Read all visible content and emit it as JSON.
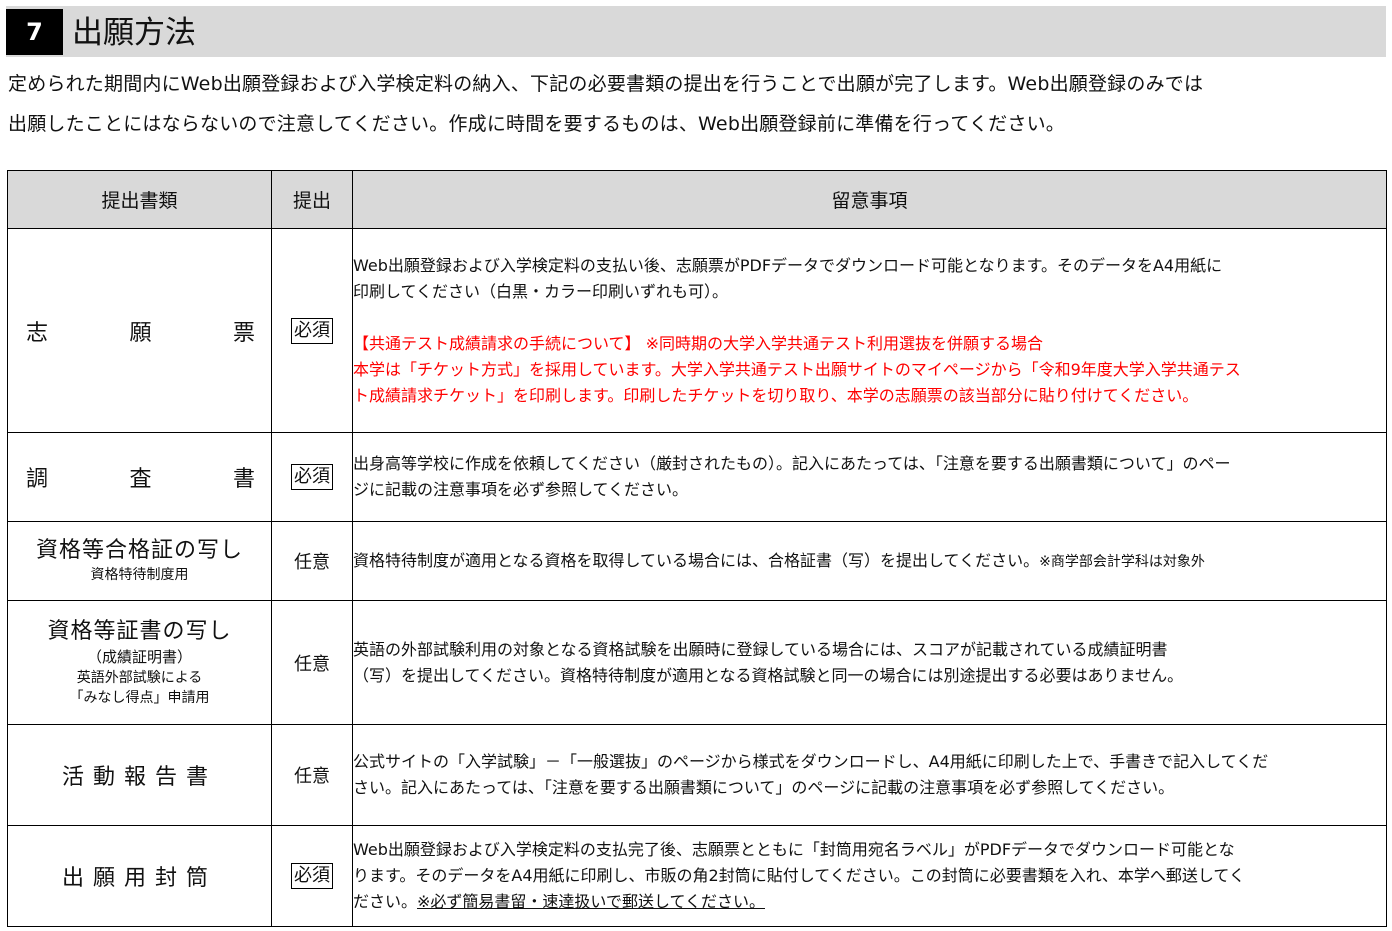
{
  "section": {
    "number": "7",
    "title": "出願方法"
  },
  "intro": {
    "line1": "定められた期間内にWeb出願登録および入学検定料の納入、下記の必要書類の提出を行うことで出願が完了します。Web出願登録のみでは",
    "line2": "出願したことにはならないので注意してください。作成に時間を要するものは、Web出願登録前に準備を行ってください。"
  },
  "table": {
    "headers": {
      "documents": "提出書類",
      "submission": "提出",
      "notes": "留意事項"
    },
    "rows": [
      {
        "name_chars": [
          "志",
          "願",
          "票"
        ],
        "submission": "必須",
        "notes": [
          "Web出願登録および入学検定料の支払い後、志願票がPDFデータでダウンロード可能となります。そのデータをA4用紙に",
          "印刷してください（白黒・カラー印刷いずれも可）。"
        ],
        "notes_red": [
          "【共通テスト成績請求の手続について】 ※同時期の大学入学共通テスト利用選抜を併願する場合",
          "本学は「チケット方式」を採用しています。大学入学共通テスト出願サイトのマイページから「令和9年度大学入学共通テス",
          "ト成績請求チケット」を印刷します。印刷したチケットを切り取り、本学の志願票の該当部分に貼り付けてください。"
        ]
      },
      {
        "name_chars": [
          "調",
          "査",
          "書"
        ],
        "submission": "必須",
        "notes": [
          "出身高等学校に作成を依頼してください（厳封されたもの）。記入にあたっては、「注意を要する出願書類について」のペー",
          "ジに記載の注意事項を必ず参照してください。"
        ]
      },
      {
        "name": "資格等合格証の写し",
        "name_sub": "資格特待制度用",
        "submission": "任意",
        "notes_main": "資格特待制度が適用となる資格を取得している場合には、合格証書（写）を提出してください。",
        "notes_small": "※商学部会計学科は対象外"
      },
      {
        "name": "資格等証書の写し",
        "name_sub1": "（成績証明書）",
        "name_sub2": "英語外部試験による",
        "name_sub3": "「みなし得点」申請用",
        "submission": "任意",
        "notes": [
          "英語の外部試験利用の対象となる資格試験を出願時に登録している場合には、スコアが記載されている成績証明書",
          "（写）を提出してください。資格特待制度が適用となる資格試験と同一の場合には別途提出する必要はありません。"
        ]
      },
      {
        "name": "活動報告書",
        "submission": "任意",
        "notes": [
          "公式サイトの「入学試験」－「一般選抜」のページから様式をダウンロードし、A4用紙に印刷した上で、手書きで記入してくだ",
          "さい。記入にあたっては、「注意を要する出願書類について」のページに記載の注意事項を必ず参照してください。"
        ]
      },
      {
        "name": "出願用封筒",
        "submission": "必須",
        "notes": [
          "Web出願登録および入学検定料の支払完了後、志願票とともに「封筒用宛名ラベル」がPDFデータでダウンロード可能とな",
          "ります。そのデータをA4用紙に印刷し、市販の角2封筒に貼付してください。この封筒に必要書類を入れ、本学へ郵送してく"
        ],
        "notes_last_plain": "ださい。",
        "notes_last_underlined": "※必ず簡易書留・速達扱いで郵送してください。"
      }
    ]
  }
}
